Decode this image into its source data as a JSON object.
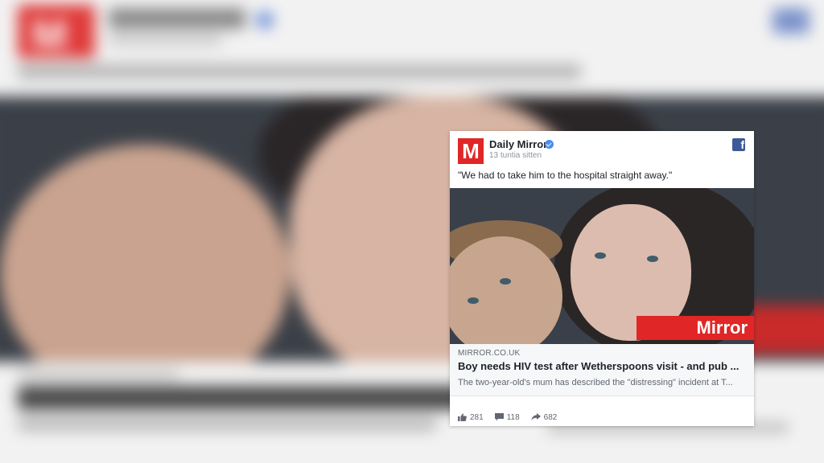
{
  "post": {
    "page_name": "Daily Mirror",
    "logo_letter": "M",
    "time": "13 tuntia sitten",
    "quote": "\"We had to take him to the hospital straight away.\"",
    "image_brand": "Mirror",
    "link": {
      "domain": "MIRROR.CO.UK",
      "headline": "Boy needs HIV test after Wetherspoons visit - and pub ...",
      "description": "The two-year-old's mum has described the \"distressing\" incident at T..."
    },
    "stats": {
      "likes": "281",
      "comments": "118",
      "shares": "682"
    }
  },
  "icons": {
    "verified": "verified-badge-icon",
    "facebook": "facebook-icon",
    "like": "thumbs-up-icon",
    "comment": "comment-icon",
    "share": "share-arrow-icon"
  },
  "colors": {
    "brand_red": "#e02626",
    "facebook_blue": "#3b5998",
    "verified_blue": "#4a8cf0"
  }
}
